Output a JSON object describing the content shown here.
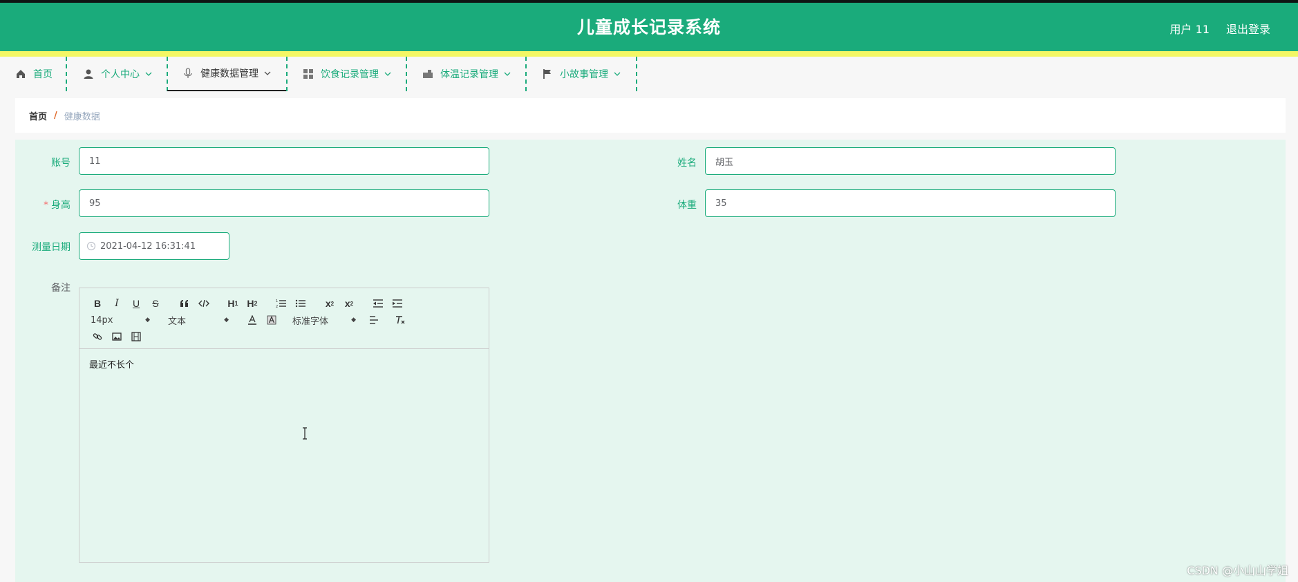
{
  "header": {
    "title": "儿童成长记录系统",
    "user_label": "用户 11",
    "logout_label": "退出登录"
  },
  "nav": {
    "items": [
      {
        "label": "首页",
        "icon": "home-icon"
      },
      {
        "label": "个人中心",
        "icon": "user-icon"
      },
      {
        "label": "健康数据管理",
        "icon": "microphone-icon"
      },
      {
        "label": "饮食记录管理",
        "icon": "grid-icon"
      },
      {
        "label": "体温记录管理",
        "icon": "mailbox-icon"
      },
      {
        "label": "小故事管理",
        "icon": "flag-icon"
      }
    ],
    "active_index": 2
  },
  "breadcrumb": {
    "home": "首页",
    "separator": "/",
    "current": "健康数据"
  },
  "form": {
    "account": {
      "label": "账号",
      "value": "11"
    },
    "name": {
      "label": "姓名",
      "value": "胡玉"
    },
    "height": {
      "required_mark": "*",
      "label": "身高",
      "value": "95"
    },
    "weight": {
      "label": "体重",
      "value": "35"
    },
    "date": {
      "label": "测量日期",
      "value": "2021-04-12 16:31:41"
    },
    "remark": {
      "label": "备注"
    }
  },
  "editor": {
    "size_select": "14px",
    "header_select": "文本",
    "font_select": "标准字体",
    "content": "最近不长个",
    "h1": "H",
    "h2": "H"
  },
  "watermark": "CSDN @小山山学姐",
  "colors": {
    "primary": "#1aab7b",
    "accent_yellow": "#f3f765",
    "panel_bg": "#e5f6ef",
    "required": "#f56c6c"
  }
}
